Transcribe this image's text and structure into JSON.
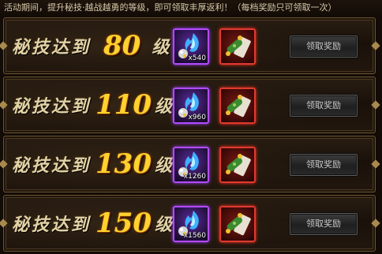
{
  "notice": "活动期间，提升秘技·越战越勇的等级，即可领取丰厚返利！（每档奖励只可领取一次）",
  "rewards": [
    {
      "label": "秘技达到",
      "level": "80",
      "unit": "级",
      "orb_qty": "x540",
      "button": "领取奖励"
    },
    {
      "label": "秘技达到",
      "level": "110",
      "unit": "级",
      "orb_qty": "x960",
      "button": "领取奖励"
    },
    {
      "label": "秘技达到",
      "level": "130",
      "unit": "级",
      "orb_qty": "x1260",
      "button": "领取奖励"
    },
    {
      "label": "秘技达到",
      "level": "150",
      "unit": "级",
      "orb_qty": "x1560",
      "button": "领取奖励"
    }
  ],
  "icons": {
    "orb_item": "blue-flame-orb-icon",
    "scroll_item": "jade-scroll-icon"
  },
  "colors": {
    "level_number": "#ffd22e",
    "orb_frame": "#b24cff",
    "scroll_frame": "#e03a30"
  }
}
